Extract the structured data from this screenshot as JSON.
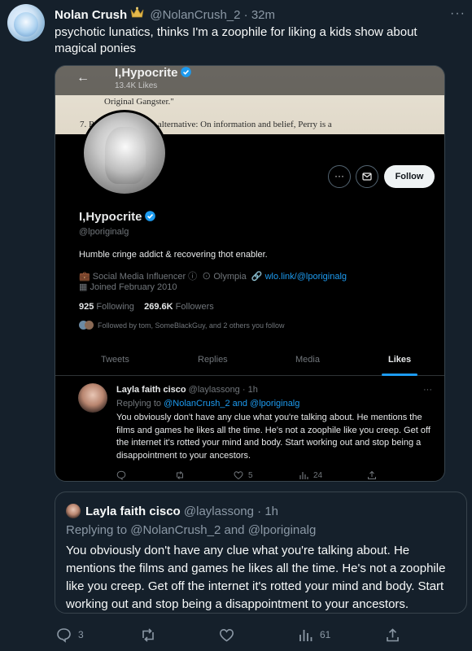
{
  "tweet": {
    "author_name": "Nolan Crush",
    "handle": "@NolanCrush_2",
    "separator": "·",
    "time": "32m",
    "text": "psychotic lunatics, thinks I'm a zoophile for liking a kids show about magical ponies"
  },
  "screenshot": {
    "topbar_name": "I,Hypocrite",
    "topbar_likes": "13.4K Likes",
    "banner_line1": "Original Gangster.\"",
    "banner_line2": "7.   Rule 8(d)(2) in the alternative: On information and belief, Perry is a",
    "more_button": "···",
    "follow_button": "Follow",
    "profile_name": "I,Hypocrite",
    "profile_handle": "@lporiginalg",
    "bio": "Humble cringe addict & recovering thot enabler.",
    "category": "Social Media Influencer",
    "location": "Olympia",
    "link": "wlo.link/@lporiginalg",
    "joined": "Joined February 2010",
    "following_count": "925",
    "following_label": "Following",
    "followers_count": "269.6K",
    "followers_label": "Followers",
    "followed_by": "Followed by tom, SomeBlackGuy, and 2 others you follow",
    "tabs": [
      "Tweets",
      "Replies",
      "Media",
      "Likes"
    ],
    "reply": {
      "name": "Layla faith cisco",
      "handle": "@laylassong",
      "time": "1h",
      "replying_prefix": "Replying to",
      "replying_mentions": "@NolanCrush_2 and @lporiginalg",
      "text": "You obviously don't have any clue what you're talking about. He mentions the films and games he likes all the time. He's not a zoophile like you creep. Get off the internet it's rotted your mind and body. Start working out and stop being a disappointment to your ancestors.",
      "likes": "5",
      "views": "24"
    }
  },
  "quote": {
    "name": "Layla faith cisco",
    "handle": "@laylassong",
    "time": "1h",
    "replying": "Replying to @NolanCrush_2 and @lporiginalg",
    "text": "You obviously don't have any clue what you're talking about. He mentions the films and games he likes all the time. He's not a zoophile like you creep. Get off the internet it's rotted your mind and body. Start working out and stop being a disappointment to your ancestors."
  },
  "actions": {
    "replies": "3",
    "views": "61"
  },
  "colors": {
    "background": "#15202b",
    "accent": "#1d9bf0",
    "muted": "#8b98a5"
  }
}
